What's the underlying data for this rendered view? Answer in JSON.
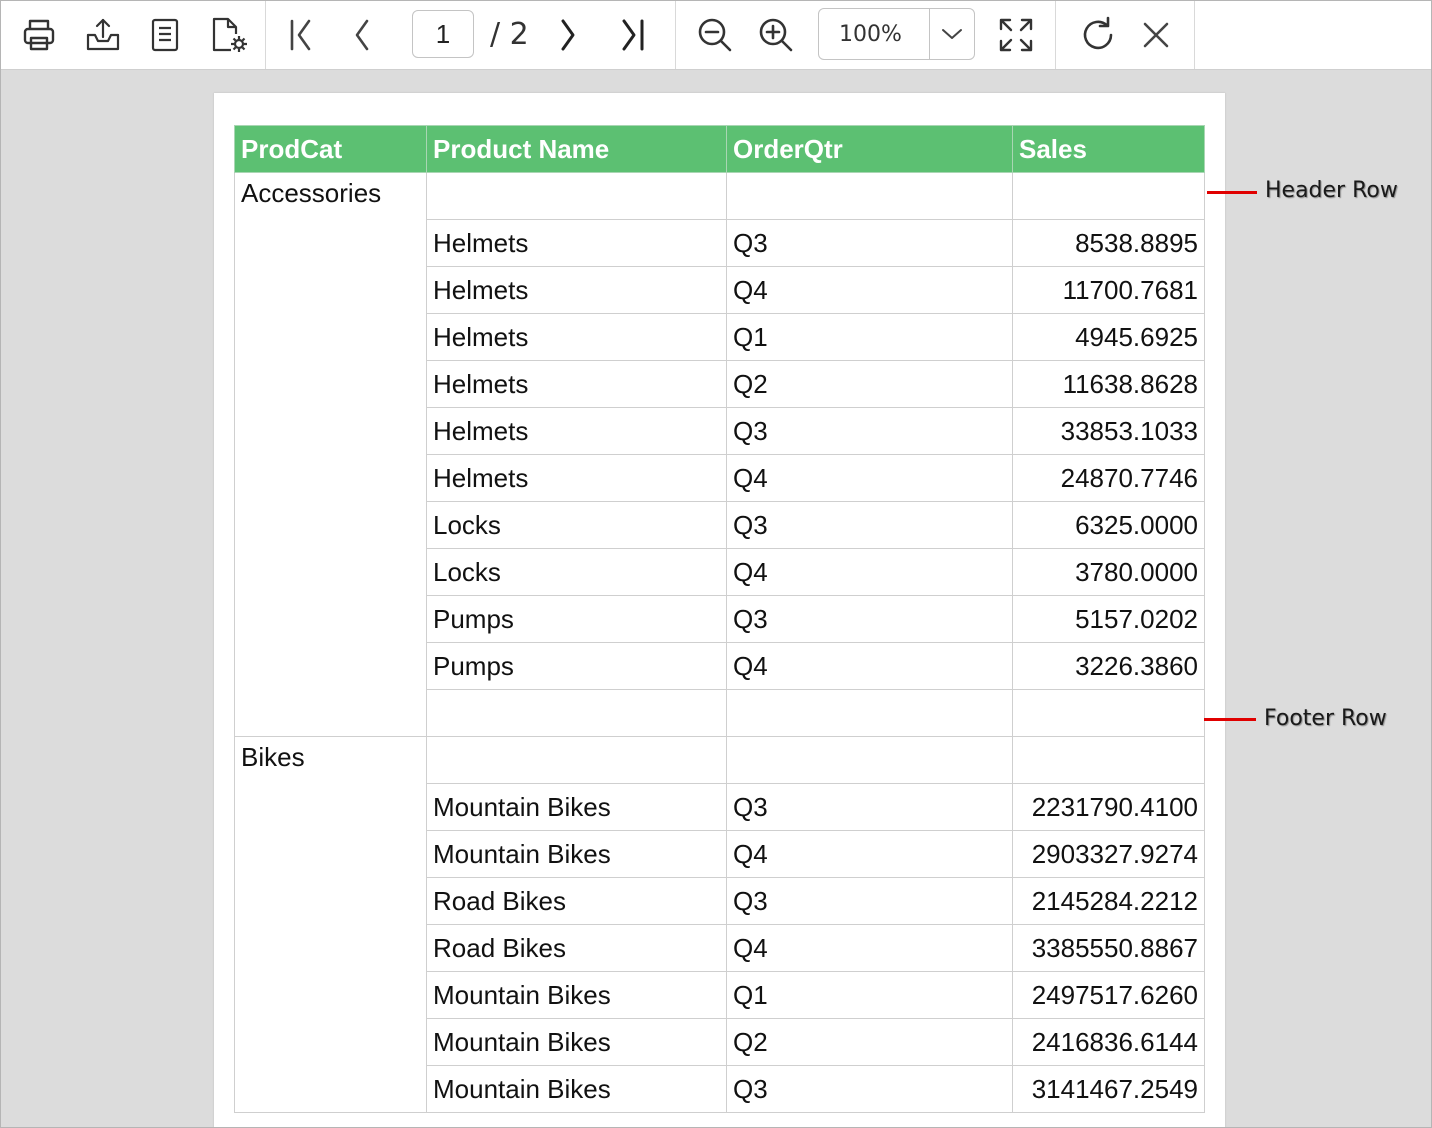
{
  "toolbar": {
    "current_page": "1",
    "page_total": "/ 2",
    "zoom": "100%",
    "icons": [
      "print-icon",
      "export-icon",
      "document-map-icon",
      "page-setup-icon",
      "first-page-icon",
      "previous-page-icon",
      "next-page-icon",
      "last-page-icon",
      "zoom-out-icon",
      "zoom-in-icon",
      "chevron-down-icon",
      "fit-page-icon",
      "refresh-icon",
      "close-icon"
    ]
  },
  "report": {
    "columns": [
      "ProdCat",
      "Product Name",
      "OrderQtr",
      "Sales"
    ],
    "header_color": "#5cc072",
    "groups": [
      {
        "category": "Accessories",
        "rows": [
          [
            "Helmets",
            "Q3",
            "8538.8895"
          ],
          [
            "Helmets",
            "Q4",
            "11700.7681"
          ],
          [
            "Helmets",
            "Q1",
            "4945.6925"
          ],
          [
            "Helmets",
            "Q2",
            "11638.8628"
          ],
          [
            "Helmets",
            "Q3",
            "33853.1033"
          ],
          [
            "Helmets",
            "Q4",
            "24870.7746"
          ],
          [
            "Locks",
            "Q3",
            "6325.0000"
          ],
          [
            "Locks",
            "Q4",
            "3780.0000"
          ],
          [
            "Pumps",
            "Q3",
            "5157.0202"
          ],
          [
            "Pumps",
            "Q4",
            "3226.3860"
          ]
        ]
      },
      {
        "category": "Bikes",
        "rows": [
          [
            "Mountain Bikes",
            "Q3",
            "2231790.4100"
          ],
          [
            "Mountain Bikes",
            "Q4",
            "2903327.9274"
          ],
          [
            "Road Bikes",
            "Q3",
            "2145284.2212"
          ],
          [
            "Road Bikes",
            "Q4",
            "3385550.8867"
          ],
          [
            "Mountain Bikes",
            "Q1",
            "2497517.6260"
          ],
          [
            "Mountain Bikes",
            "Q2",
            "2416836.6144"
          ],
          [
            "Mountain Bikes",
            "Q3",
            "3141467.2549"
          ]
        ]
      }
    ]
  },
  "annotations": {
    "header_row": "Header Row",
    "footer_row": "Footer Row",
    "line_color": "#e00000"
  }
}
